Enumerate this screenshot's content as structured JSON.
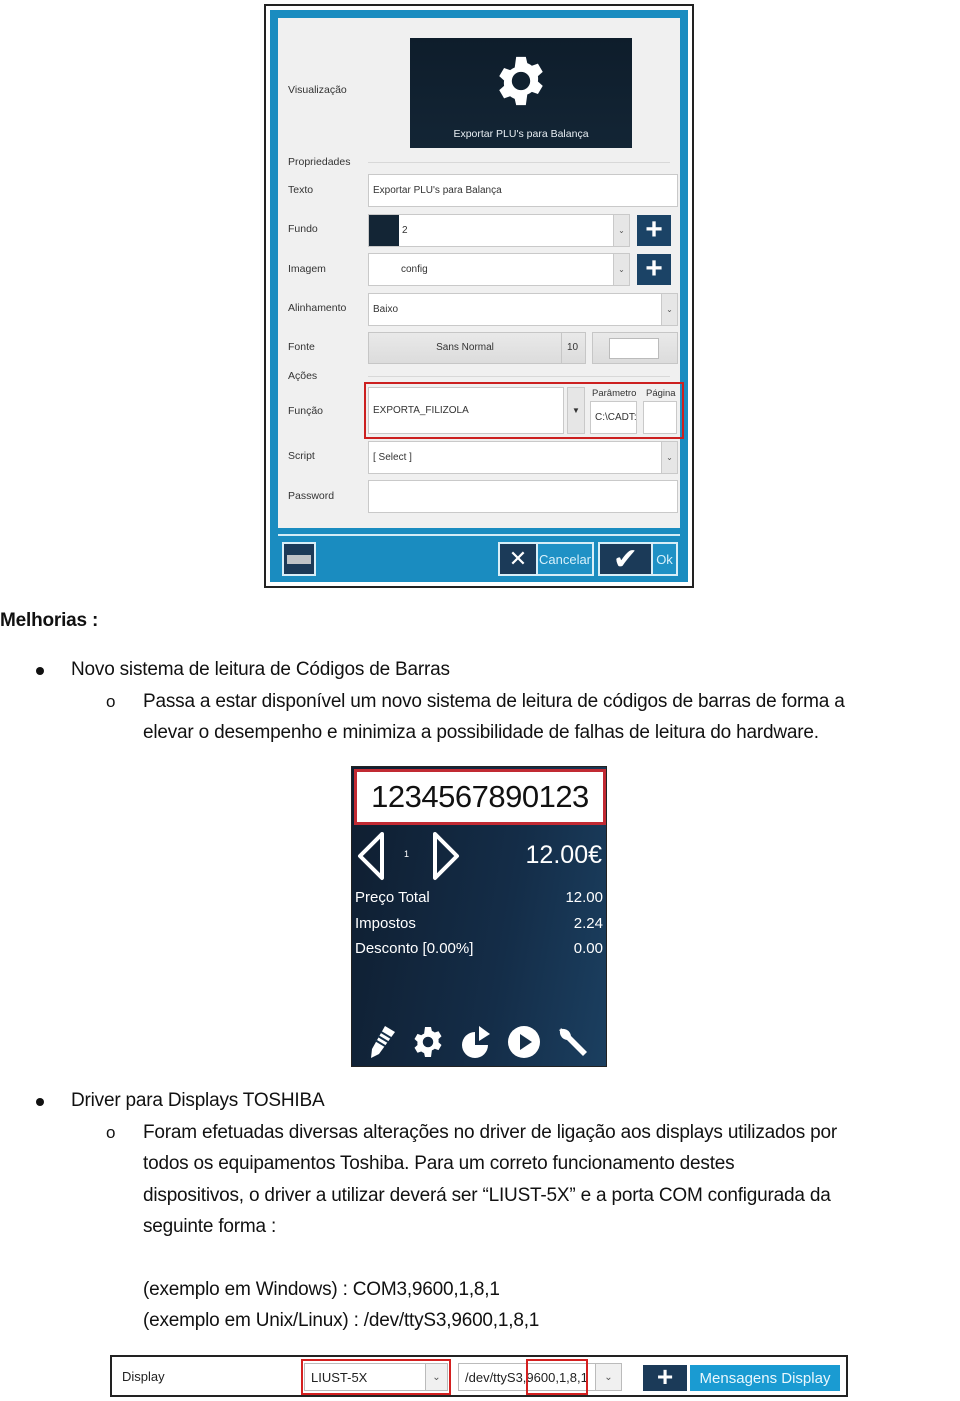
{
  "dialog": {
    "labels": {
      "preview": "Visualização",
      "properties": "Propriedades",
      "text": "Texto",
      "background": "Fundo",
      "image": "Imagem",
      "alignment": "Alinhamento",
      "font": "Fonte",
      "actions": "Ações",
      "function": "Função",
      "script": "Script",
      "password": "Password",
      "parameter": "Parâmetro",
      "page": "Página"
    },
    "preview_caption": "Exportar PLU's para Balança",
    "preview_icon": "gear-icon",
    "text_value": "Exportar PLU's para Balança",
    "background_value": "2",
    "background_swatch": "#132535",
    "image_value": "config",
    "alignment_value": "Baixo",
    "font_name": "Sans Normal",
    "font_size": "10",
    "function_value": "EXPORTA_FILIZOLA",
    "parameter_value": "C:\\CADT:",
    "page_value": "",
    "script_value": "[ Select ]",
    "password_value": "",
    "cancel_label": "Cancelar",
    "ok_label": "Ok",
    "accent_color": "#1a8cc0",
    "highlight_color": "#cc2020"
  },
  "document": {
    "heading": "Melhorias :",
    "items": [
      {
        "title": "Novo sistema de leitura de Códigos de Barras",
        "sub_lines": [
          "Passa a estar disponível um novo sistema de leitura de códigos de barras de forma a",
          "elevar o desempenho e minimiza a possibilidade de falhas de leitura do hardware."
        ]
      },
      {
        "title": "Driver para Displays TOSHIBA",
        "sub_lines": [
          "Foram efetuadas diversas alterações no driver de ligação aos displays utilizados por",
          "todos os equipamentos Toshiba. Para um correto funcionamento destes",
          "dispositivos, o driver a utilizar deverá ser “LIUST-5X” e a porta COM configurada da",
          "seguinte forma :"
        ],
        "examples": [
          "(exemplo em Windows) : COM3,9600,1,8,1",
          "(exemplo em Unix/Linux) : /dev/ttyS3,9600,1,8,1"
        ]
      }
    ]
  },
  "pos": {
    "barcode": "1234567890123",
    "page": "1",
    "total_display": "12.00€",
    "rows": [
      {
        "label": "Preço Total",
        "value": "12.00"
      },
      {
        "label": "Impostos",
        "value": "2.24"
      },
      {
        "label": "Desconto [0.00%]",
        "value": "0.00"
      }
    ],
    "toolbar_icons": [
      "pencil-icon",
      "gear-icon",
      "pie-chart-icon",
      "play-icon",
      "wrench-icon"
    ]
  },
  "display_bar": {
    "label": "Display",
    "driver_value": "LIUST-5X",
    "port_value": "/dev/ttyS3,9600,1,8,1",
    "messages_label": "Mensagens Display"
  }
}
